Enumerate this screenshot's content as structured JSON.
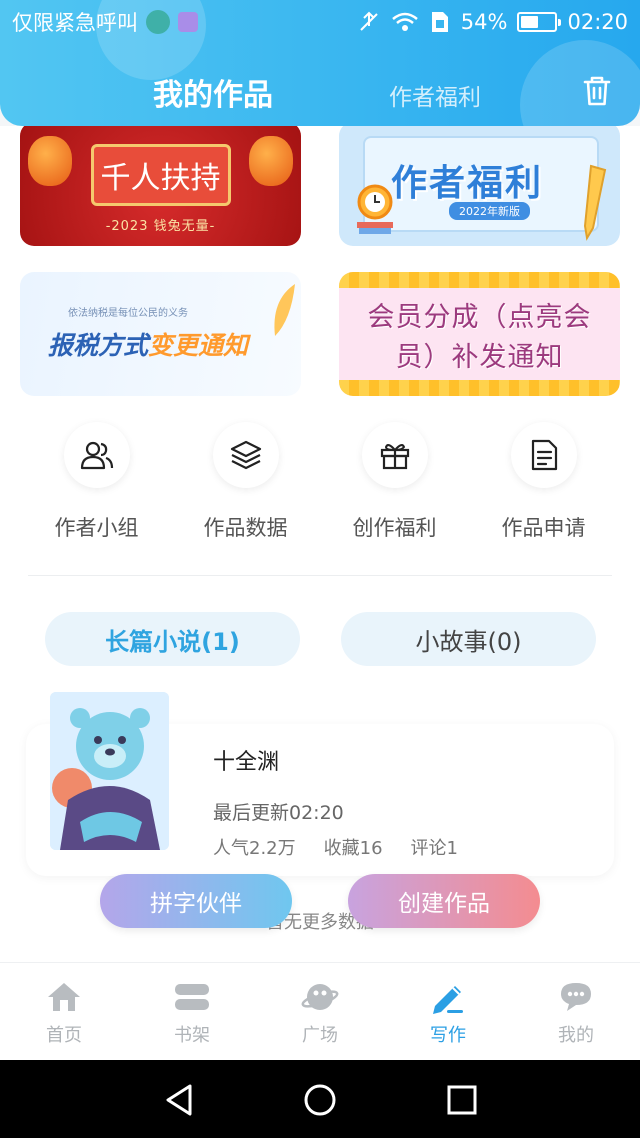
{
  "status_bar": {
    "carrier": "仅限紧急呼叫",
    "battery_percent_text": "54%",
    "battery_level": 0.54,
    "time": "02:20"
  },
  "header": {
    "active_tab": "我的作品",
    "other_tab": "作者福利"
  },
  "banners": {
    "banner1": {
      "title": "千人扶持",
      "subtitle": "-2023 钱兔无量-"
    },
    "banner2": {
      "title": "作者福利",
      "tag": "2022年新版"
    },
    "banner3": {
      "small": "依法纳税是每位公民的义务",
      "title_a": "报税方式",
      "title_b": "变更通知"
    },
    "banner4": {
      "line1": "会员分成（点亮会",
      "line2": "员）补发通知"
    }
  },
  "quick_actions": [
    {
      "label": "作者小组",
      "icon": "users-icon"
    },
    {
      "label": "作品数据",
      "icon": "layers-icon"
    },
    {
      "label": "创作福利",
      "icon": "gift-icon"
    },
    {
      "label": "作品申请",
      "icon": "document-icon"
    }
  ],
  "categories": {
    "long_novel": "长篇小说(1)",
    "short_story": "小故事(0)"
  },
  "work": {
    "title": "十全渊",
    "last_update": "最后更新02:20",
    "popularity": "人气2.2万",
    "favorites": "收藏16",
    "comments": "评论1"
  },
  "list_footer": "暂无更多数据",
  "actions": {
    "partner": "拼字伙伴",
    "create": "创建作品"
  },
  "bottom_nav": [
    {
      "label": "首页",
      "icon": "home-icon"
    },
    {
      "label": "书架",
      "icon": "bookshelf-icon"
    },
    {
      "label": "广场",
      "icon": "planet-icon"
    },
    {
      "label": "写作",
      "icon": "pen-icon"
    },
    {
      "label": "我的",
      "icon": "chat-bubble-icon"
    }
  ],
  "colors": {
    "header_blue": "#39b6f0",
    "accent_blue": "#2b9fe4",
    "partner_gradient_start": "#b4a6ea",
    "create_gradient_end": "#f48c90"
  }
}
